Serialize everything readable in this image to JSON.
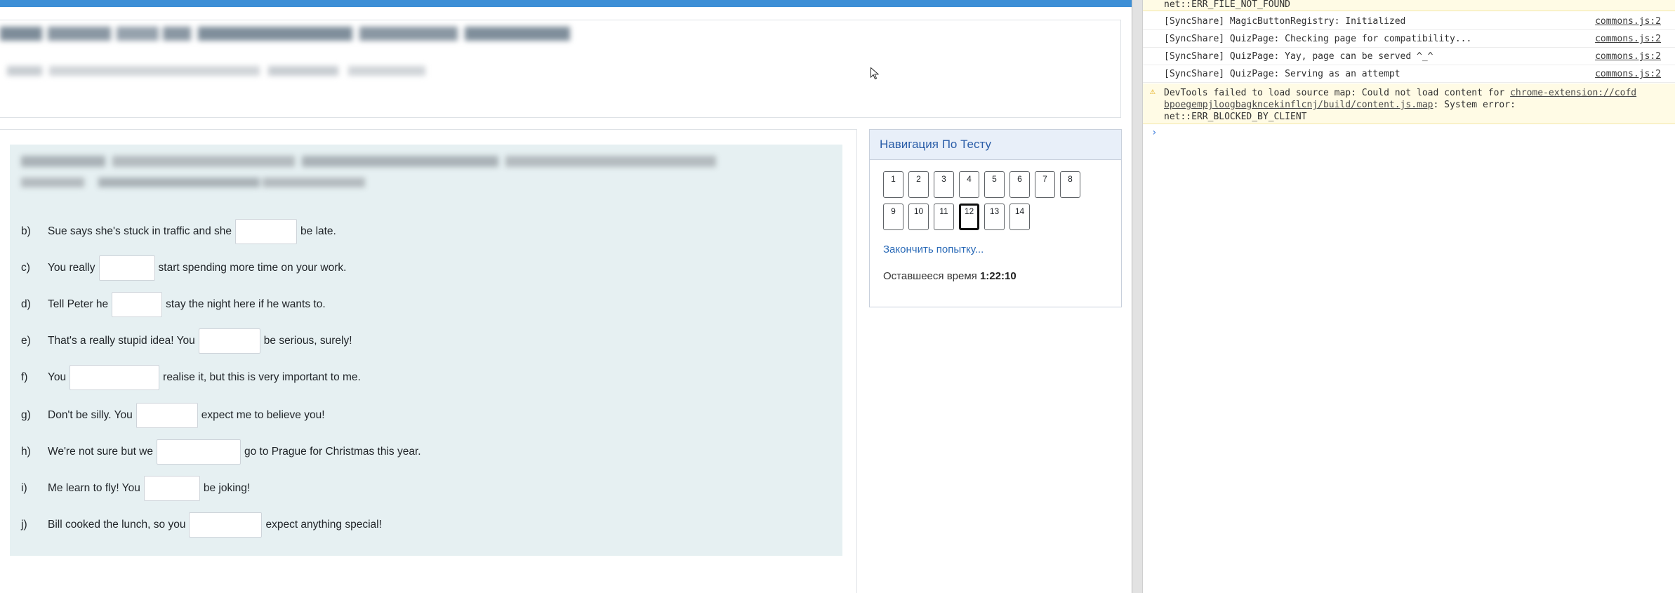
{
  "quiz": {
    "questions": [
      {
        "letter": "b)",
        "before": "Sue says she's stuck in traffic and she",
        "after": "be late."
      },
      {
        "letter": "c)",
        "before": "You really",
        "after": "start spending more time on your work."
      },
      {
        "letter": "d)",
        "before": "Tell Peter he",
        "after": "stay the night here if he wants to."
      },
      {
        "letter": "e)",
        "before": "That's a really stupid idea! You",
        "after": "be serious, surely!"
      },
      {
        "letter": "f)",
        "before": "You",
        "after": "realise it, but this is very important to me."
      },
      {
        "letter": "g)",
        "before": "Don't be silly. You",
        "after": "expect me to believe you!"
      },
      {
        "letter": "h)",
        "before": "We're not sure but we",
        "after": "go to Prague for Christmas this year."
      },
      {
        "letter": "i)",
        "before": "Me learn to fly! You",
        "after": "be joking!"
      },
      {
        "letter": "j)",
        "before": "Bill cooked the lunch, so you",
        "after": "expect anything special!"
      }
    ]
  },
  "nav": {
    "title": "Навигация По Тесту",
    "buttons": [
      "1",
      "2",
      "3",
      "4",
      "5",
      "6",
      "7",
      "8",
      "9",
      "10",
      "11",
      "12",
      "13",
      "14"
    ],
    "current": "12",
    "finish_label": "Закончить попытку...",
    "timer_label": "Оставшееся время",
    "timer_value": "1:22:10"
  },
  "devtools": {
    "lines": [
      {
        "text": "net::ERR_FILE_NOT_FOUND",
        "source": ""
      },
      {
        "text": "[SyncShare] MagicButtonRegistry: Initialized",
        "source": "commons.js:2"
      },
      {
        "text": "[SyncShare] QuizPage: Checking page for compatibility...",
        "source": "commons.js:2"
      },
      {
        "text": "[SyncShare] QuizPage: Yay, page can be served ^_^",
        "source": "commons.js:2"
      },
      {
        "text": "[SyncShare] QuizPage: Serving as an attempt",
        "source": "commons.js:2"
      }
    ],
    "warning": {
      "prefix": "DevTools failed to load source map: Could not load content for ",
      "link_part1": "chrome-extension://cofd",
      "link_part2": "bpoegempjloogbagkncekinflcnj/build/content.js.map",
      "suffix": ": System error:",
      "line3": "net::ERR_BLOCKED_BY_CLIENT"
    },
    "prompt": "›"
  },
  "colors": {
    "topbar": "#3d8fd6",
    "question_bg": "#e6f0f2",
    "nav_header_bg": "#e8eff9",
    "link": "#2a6ab7",
    "warning_bg": "#fffbe5"
  }
}
